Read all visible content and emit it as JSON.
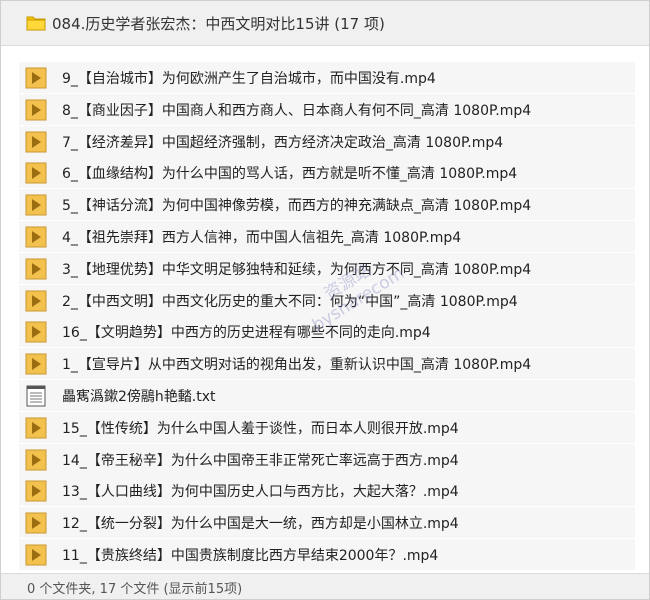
{
  "window": {
    "title": "084.历史学者张宏杰：中西文明对比15讲 (17 项)"
  },
  "files": [
    {
      "name": "9_【自治城市】为何欧洲产生了自治城市，而中国没有.mp4",
      "type": "video"
    },
    {
      "name": "8_【商业因子】中国商人和西方商人、日本商人有何不同_高清 1080P.mp4",
      "type": "video"
    },
    {
      "name": "7_【经济差异】中国超经济强制，西方经济决定政治_高清 1080P.mp4",
      "type": "video"
    },
    {
      "name": "6_【血缘结构】为什么中国的骂人话，西方就是听不懂_高清 1080P.mp4",
      "type": "video"
    },
    {
      "name": "5_【神话分流】为何中国神像劳模，而西方的神充满缺点_高清 1080P.mp4",
      "type": "video"
    },
    {
      "name": "4_【祖先崇拜】西方人信神，而中国人信祖先_高清 1080P.mp4",
      "type": "video"
    },
    {
      "name": "3_【地理优势】中华文明足够独特和延续，为何西方不同_高清 1080P.mp4",
      "type": "video"
    },
    {
      "name": "2_【中西文明】中西文化历史的重大不同：何为“中国”_高清 1080P.mp4",
      "type": "video"
    },
    {
      "name": "16_【文明趋势】中西方的历史进程有哪些不同的走向.mp4",
      "type": "video"
    },
    {
      "name": "1_【宣导片】从中西文明对话的视角出发，重新认识中国_高清 1080P.mp4",
      "type": "video"
    },
    {
      "name": "畾寯潙鏉2傍鷊h艳濌.txt",
      "type": "text"
    },
    {
      "name": "15_【性传统】为什么中国人羞于谈性，而日本人则很开放.mp4",
      "type": "video"
    },
    {
      "name": "14_【帝王秘辛】为什么中国帝王非正常死亡率远高于西方.mp4",
      "type": "video"
    },
    {
      "name": "13_【人口曲线】为何中国历史人口与西方比，大起大落？.mp4",
      "type": "video"
    },
    {
      "name": "12_【统一分裂】为什么中国是大一统，西方却是小国林立.mp4",
      "type": "video"
    },
    {
      "name": "11_【贵族终结】中国贵族制度比西方早结束2000年？.mp4",
      "type": "video"
    }
  ],
  "status": {
    "text": "0 个文件夹, 17 个文件 (显示前15项)"
  },
  "watermark": {
    "line1": "资源站",
    "line2": "bysharecom"
  },
  "colors": {
    "folder": "#f5c400",
    "video_icon_bg": "#f2c14e",
    "video_icon_play": "#9a6d10",
    "row_bg": "#f6f6f6"
  },
  "icons": {
    "title": "folder-icon",
    "video": "play-file-icon",
    "text": "text-file-icon"
  }
}
